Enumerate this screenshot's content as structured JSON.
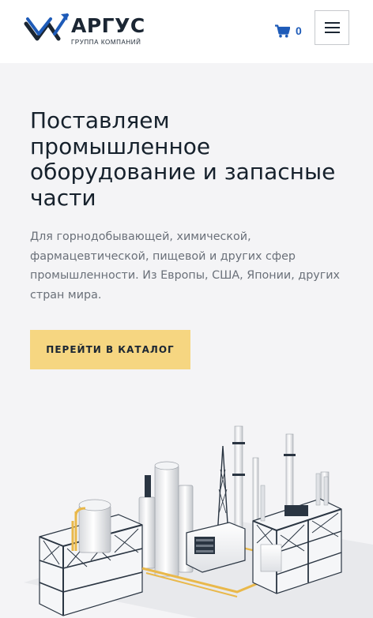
{
  "header": {
    "logo_name": "АРГУС",
    "logo_tagline": "ГРУППА КОМПАНИЙ",
    "cart_count": "0",
    "icons": {
      "cart": "shopping-cart-icon",
      "menu": "hamburger-menu-icon"
    }
  },
  "hero": {
    "title": "Поставляем промышленное оборудование и запасные части",
    "description": "Для горнодобывающей, химической, фармацевтической, пищевой и других сфер промышленности. Из Европы, США, Японии, других стран мира.",
    "cta_label": "ПЕРЕЙТИ В КАТАЛОГ"
  },
  "colors": {
    "brand_blue": "#1e5bb8",
    "cta_yellow": "#f6d681",
    "text_dark": "#16212c",
    "text_muted": "#6a7079",
    "background": "#f4f4f6"
  }
}
